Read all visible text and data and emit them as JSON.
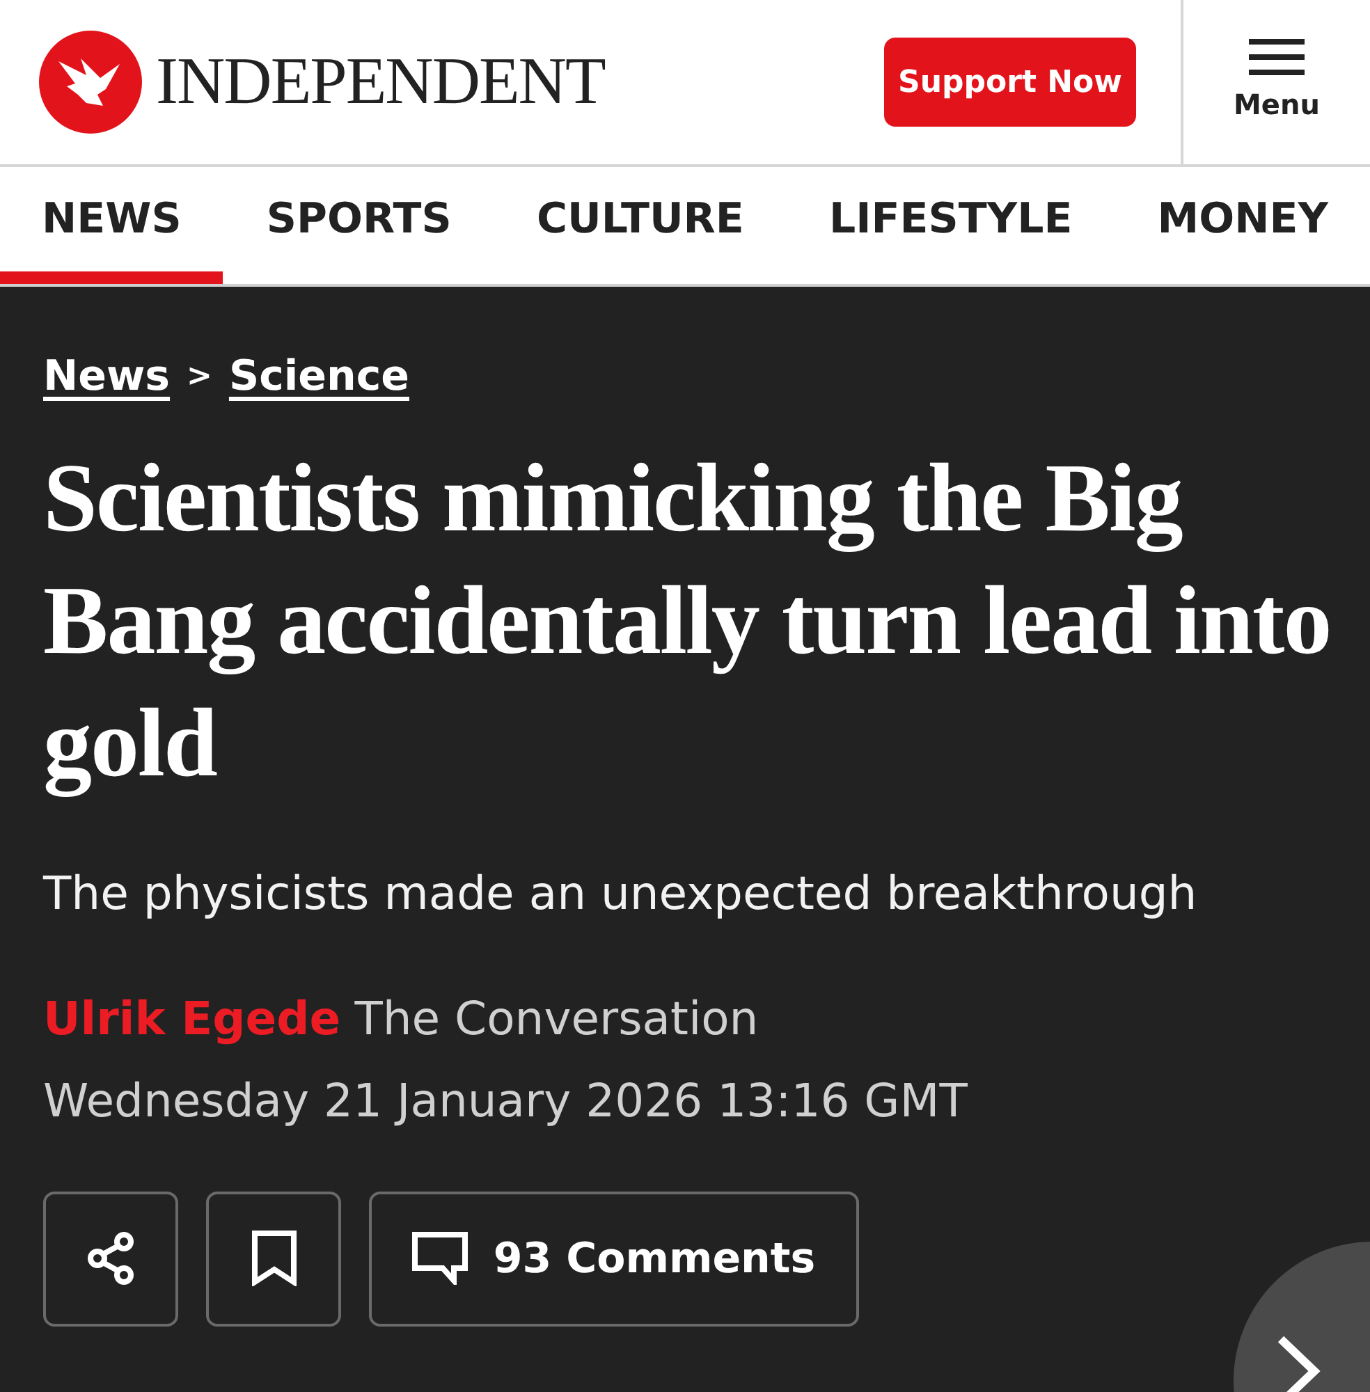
{
  "header": {
    "logo_text": "INDEPENDENT",
    "support_button": "Support Now",
    "menu_label": "Menu"
  },
  "nav": [
    {
      "label": "NEWS",
      "selected": true
    },
    {
      "label": "SPORTS",
      "selected": false
    },
    {
      "label": "CULTURE",
      "selected": false
    },
    {
      "label": "LIFESTYLE",
      "selected": false
    },
    {
      "label": "MONEY",
      "selected": false
    }
  ],
  "breadcrumb": [
    "News",
    ">",
    "Science"
  ],
  "headline": "Scientists mimicking the Big Bang accidentally turn lead into gold",
  "standfirst": "The physicists made an unexpected breakthrough",
  "author": "Ulrik Egede",
  "publication": "The Conversation",
  "date": "Wednesday 21 January 2026 13:16 GMT",
  "comments_button": "93 Comments"
}
